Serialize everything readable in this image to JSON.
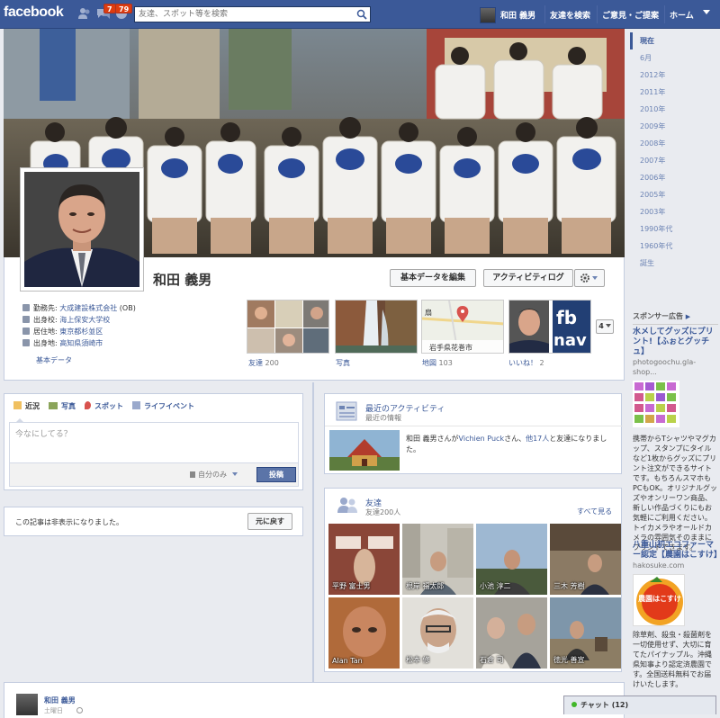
{
  "topbar": {
    "logo": "facebook",
    "friend_requests_badge": "",
    "messages_badge": "7",
    "notifications_badge": "79",
    "search_placeholder": "友達、スポット等を検索",
    "user_name": "和田 義男",
    "find_friends": "友達を検索",
    "feedback": "ご意見・ご提案",
    "home": "ホーム",
    "colors": {
      "brand": "#3b5998",
      "badge": "#dd3c10"
    }
  },
  "profile": {
    "name": "和田 義男",
    "edit_button": "基本データを編集",
    "activity_log_button": "アクティビティログ",
    "gear_icon": "gear-icon",
    "info": [
      {
        "label": "勤務先: ",
        "value": "大成建設株式会社",
        "suffix": " (OB)"
      },
      {
        "label": "出身校: ",
        "value": "海上保安大学校",
        "suffix": ""
      },
      {
        "label": "居住地: ",
        "value": "東京都杉並区",
        "suffix": ""
      },
      {
        "label": "出身地: ",
        "value": "高知県須崎市",
        "suffix": ""
      }
    ],
    "basic_data_link": "基本データ",
    "apps": [
      {
        "label": "友達",
        "count": "200"
      },
      {
        "label": "写真",
        "count": ""
      },
      {
        "label": "地図",
        "count": "103"
      },
      {
        "label": "いいね！",
        "count": "2"
      }
    ],
    "map_caption": "岩手県花巻市",
    "map_text": "扇",
    "more_count": "4"
  },
  "composer": {
    "tabs": [
      "近況",
      "写真",
      "スポット",
      "ライフイベント"
    ],
    "placeholder": "今なにしてる？",
    "privacy": "自分のみ",
    "post_button": "投稿"
  },
  "hidden_post": {
    "text": "この記事は非表示になりました。",
    "undo_button": "元に戻す"
  },
  "recent_activity": {
    "title": "最近のアクティビティ",
    "subtitle": "最近の情報",
    "text_pre": "和田 義男さんが",
    "friend_link": "Vichien Puck",
    "text_mid": "さん、",
    "others_link": "他17人",
    "text_post": "と友達になりました。"
  },
  "friends": {
    "title": "友達",
    "subtitle": "友達200人",
    "see_all": "すべて見る",
    "names": [
      "平野 富士男",
      "根岸 福太郎",
      "小池 淳二",
      "三木 芳樹",
      "Alan Tan",
      "松本 修",
      "石倉 司",
      "徳光 善宣"
    ]
  },
  "bottom_post": {
    "name": "和田 義男",
    "date": "土曜日"
  },
  "chat": {
    "label": "チャット (12)"
  },
  "years": [
    "現在",
    "6月",
    "2012年",
    "2011年",
    "2010年",
    "2009年",
    "2008年",
    "2007年",
    "2006年",
    "2005年",
    "2003年",
    "1990年代",
    "1960年代",
    "誕生"
  ],
  "ads": {
    "header": "スポンサー広告",
    "more": "▶",
    "ad1": {
      "title": "水メしてグッズにプリント!【ふぉとグッチュ】",
      "host": "photogoochu.gla-shop...",
      "body": "携帯からTシャツやマグカップ、スタンプにタイルなど1枚からグッズにプリント注文ができるサイトです。もちろんスマホもPCもOK。オリジナルグッズやオンリーワン商品、新しい作品づくりにもお気軽にご利用ください。トイカメラやオールドカメラの雰囲気そのままにプリントできます。"
    },
    "ad2": {
      "title": "八重山初エコファーマー認定【農園はこすけ】",
      "host": "hakosuke.com",
      "logo_text": "農園はこすけ",
      "body": "除草剤、殺虫・殺菌剤を一切使用せず、大切に育てたパイナップル。沖縄県知事より認定済農園です。全国送料無料でお届けいたします。"
    }
  }
}
